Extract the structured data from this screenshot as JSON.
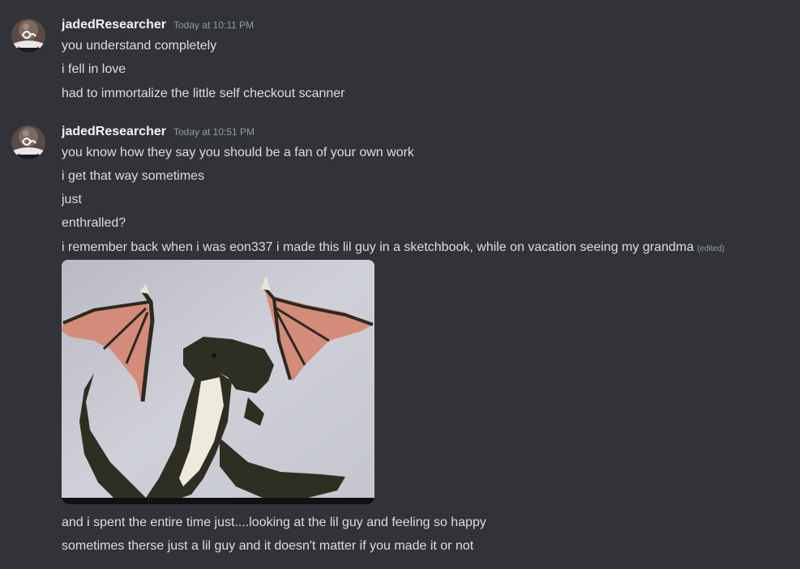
{
  "messages": [
    {
      "username": "jadedResearcher",
      "timestamp": "Today at 10:11 PM",
      "lines": [
        "you understand completely",
        "i fell in love",
        "had to immortalize the little self checkout scanner"
      ]
    },
    {
      "username": "jadedResearcher",
      "timestamp": "Today at 10:51 PM",
      "lines": [
        "you know how they say you should be a fan of your own work",
        "i get that way sometimes",
        "just",
        "enthralled?",
        "i remember back when i was eon337 i made this lil guy in a sketchbook, while on vacation seeing my grandma"
      ],
      "edited_label": "(edited)",
      "after_image_lines": [
        "and i spent the entire time just....looking at the lil guy and feeling so happy",
        "sometimes therse just a lil guy and it doesn't matter if you made it or not"
      ]
    }
  ],
  "colors": {
    "background": "#313338",
    "username": "#f2f3f5",
    "text": "#dbdee1",
    "muted": "#949ba4"
  },
  "icons": {
    "avatar": "avatar-image",
    "attachment": "dragon-drawing-image"
  }
}
